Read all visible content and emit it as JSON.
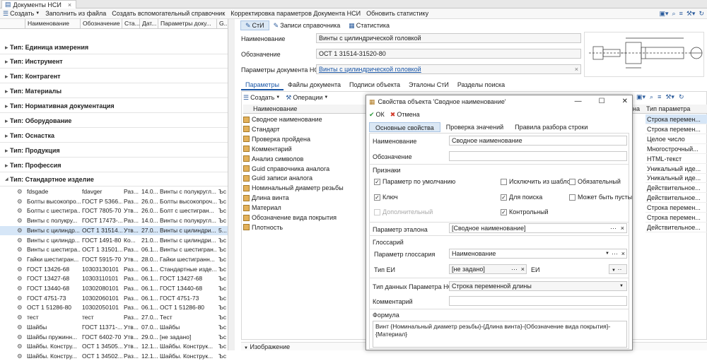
{
  "window_tab": {
    "title": "Документы НСИ"
  },
  "toolbar": {
    "create": "Создать",
    "fill_from_file": "Заполнить из файла",
    "create_aux": "Создать вспомогательный справочник",
    "correct_params": "Корректировка параметров Документа НСИ",
    "update_stats": "Обновить статистику"
  },
  "left": {
    "columns": [
      "Наименование",
      "Обозначение",
      "Ста...",
      "Дат...",
      "Параметры доку...",
      "G..."
    ],
    "groups": [
      "Тип: Единица измерения",
      "Тип: Инструмент",
      "Тип: Контрагент",
      "Тип: Материалы",
      "Тип: Нормативная документация",
      "Тип: Оборудование",
      "Тип: Оснастка",
      "Тип: Продукция",
      "Тип: Профессия",
      "Тип: Стандартное изделие"
    ],
    "rows": [
      [
        "fdsgade",
        "fdavger",
        "Раз...",
        "14.0...",
        "Винты с полукругл...",
        "Ъс"
      ],
      [
        "Болты высокопро...",
        "ГОСТ Р 5366...",
        "Раз...",
        "26.0...",
        "Болты высокопроч...",
        "Ъс"
      ],
      [
        "Болты с шестигра...",
        "ГОСТ 7805-70",
        "Утв...",
        "26.0...",
        "Болт с шестигран...",
        "Ъс"
      ],
      [
        "Винты с полукру...",
        "ГОСТ 17473-...",
        "Раз...",
        "14.0...",
        "Винты с полукругл...",
        "Ъс"
      ],
      [
        "Винты с цилиндр...",
        "ОСТ 1 31514...",
        "Утв...",
        "27.0...",
        "Винты с цилиндри...",
        "5..."
      ],
      [
        "Винты с цилиндр...",
        "ГОСТ 1491-80",
        "Ко...",
        "21.0...",
        "Винты с цилиндри...",
        "Ъс"
      ],
      [
        "Винты с шестигра...",
        "ОСТ 1 31501...",
        "Раз...",
        "06.1...",
        "Винты с шестигран...",
        "Ъс"
      ],
      [
        "Гайки шестигран...",
        "ГОСТ 5915-70",
        "Утв...",
        "28.0...",
        "Гайки шестигранн...",
        "Ъс"
      ],
      [
        "ГОСТ 13426-68",
        "10303130101",
        "Раз...",
        "06.1...",
        "Стандартные изде...",
        "Ъс"
      ],
      [
        "ГОСТ 13427-68",
        "10303110101",
        "Раз...",
        "06.1...",
        "ГОСТ 13427-68",
        "Ъс"
      ],
      [
        "ГОСТ 13440-68",
        "10302080101",
        "Раз...",
        "06.1...",
        "ГОСТ 13440-68",
        "Ъс"
      ],
      [
        "ГОСТ 4751-73",
        "10302060101",
        "Раз...",
        "06.1...",
        "ГОСТ 4751-73",
        "Ъс"
      ],
      [
        "ОСТ 1 51286-80",
        "10302050101",
        "Раз...",
        "06.1...",
        "ОСТ 1 51286-80",
        "Ъс"
      ],
      [
        "тест",
        "тест",
        "Раз...",
        "27.0...",
        "Тест",
        "Ъс"
      ],
      [
        "Шайбы",
        "ГОСТ 11371-...",
        "Утв...",
        "07.0...",
        "Шайбы",
        "Ъс"
      ],
      [
        "Шайбы пружинн...",
        "ГОСТ 6402-70",
        "Утв...",
        "29.0...",
        "[не задано]",
        "Ъс"
      ],
      [
        "Шайбы. Констру...",
        "ОСТ 1 34505...",
        "Утв...",
        "12.1...",
        "Шайбы. Конструк...",
        "Ъс"
      ],
      [
        "Шайбы. Констру...",
        "ОСТ 1 34502...",
        "Раз...",
        "12.1...",
        "Шайбы. Конструк...",
        "Ъс"
      ]
    ]
  },
  "right": {
    "tabs": [
      "СтИ",
      "Записи справочника",
      "Статистика"
    ],
    "name_label": "Наименование",
    "name_value": "Винты с цилиндрической головкой",
    "designation_label": "Обозначение",
    "designation_value": "ОСТ 1 31514-31520-80",
    "params_label": "Параметры документа НСИ",
    "params_value": "Винты с цилиндрической головкой",
    "subtabs": [
      "Параметры",
      "Файлы документа",
      "Подписи объекта",
      "Эталоны СтИ",
      "Разделы поиска"
    ],
    "create": "Создать",
    "operations": "Операции",
    "col_name": "Наименование",
    "col_type_short": "на",
    "col_type": "Тип параметра",
    "params": [
      "Сводное наименование",
      "Стандарт",
      "Проверка пройдена",
      "Комментарий",
      "Анализ символов",
      "Guid справочника аналога",
      "Guid записи аналога",
      "Номинальный диаметр резьбы",
      "Длина винта",
      "Материал",
      "Обозначение вида покрытия",
      "Плотность"
    ],
    "types": [
      "Строка перемен...",
      "Строка перемен...",
      "Целое число",
      "Многострочный...",
      "HTML-текст",
      "Уникальный иде...",
      "Уникальный иде...",
      "Действительное...",
      "Действительное...",
      "Строка перемен...",
      "Строка перемен...",
      "Действительное..."
    ],
    "image_section": "Изображение"
  },
  "dialog": {
    "title": "Свойства объекта 'Сводное наименование'",
    "ok": "ОК",
    "cancel": "Отмена",
    "tabs": [
      "Основные свойства",
      "Проверка значений",
      "Правила разбора строки"
    ],
    "name_label": "Наименование",
    "name_value": "Сводное наименование",
    "designation_label": "Обозначение",
    "signs_label": "Признаки",
    "cb_default": "Параметр по умолчанию",
    "cb_exclude": "Исключить из шабло",
    "cb_required": "Обязательный",
    "cb_key": "Ключ",
    "cb_search": "Для поиска",
    "cb_empty": "Может быть пусты",
    "cb_extra": "Дополнительный",
    "cb_control": "Контрольный",
    "etalon_label": "Параметр эталона",
    "etalon_value": "[Сводное наименование]",
    "glossary_label": "Глоссарий",
    "glossary_param_label": "Параметр глоссария",
    "glossary_param_value": "Наименование",
    "unit_type_label": "Тип ЕИ",
    "unit_type_value": "[не задано]",
    "unit_label": "ЕИ",
    "datatype_label": "Тип данных Параметра НСИ",
    "datatype_value": "Строка переменной длины",
    "comment_label": "Комментарий",
    "formula_label": "Формула",
    "formula_value": "Винт {Номинальный диаметр резьбы}-{Длина винта}-{Обозначение вида покрытия}-{Материал}"
  }
}
